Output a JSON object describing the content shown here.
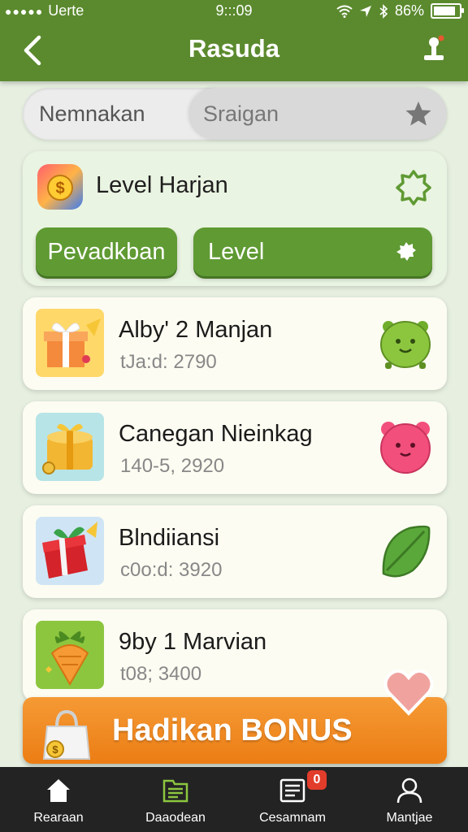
{
  "status_bar": {
    "carrier": "Uerte",
    "time": "9:::09",
    "battery": "86%",
    "battery_level": 0.86
  },
  "header": {
    "title": "Rasuda",
    "back_icon": "chevron-left-icon",
    "profile_icon": "profile-icon"
  },
  "segment": {
    "left_label": "Nemnakan",
    "right_label": "Sraigan",
    "right_icon": "star-icon"
  },
  "level_card": {
    "title": "Level Harjan",
    "primary_button": "Pevadkban",
    "secondary_button": "Level",
    "badge_icon": "gear-badge-icon"
  },
  "items": [
    {
      "name": "Alby' 2 Manjan",
      "sub": "tJa:d: 2790",
      "thumb_color": "#ffd86a",
      "pet_color": "#8cc63f"
    },
    {
      "name": "Canegan Nieinkag",
      "sub": "140-5, 2920",
      "thumb_color": "#b7e4e6",
      "pet_color": "#f24f7c"
    },
    {
      "name": "Blndiiansi",
      "sub": "c0o:d: 3920",
      "thumb_color": "#cfe5f5",
      "pet_color": "#5aa83a"
    },
    {
      "name": "9by 1 Marvian",
      "sub": "t08; 3400",
      "thumb_color": "#8cc63f",
      "pet_color": "#f59a35"
    }
  ],
  "bonus": {
    "label": "Hadikan BONUS"
  },
  "nav": [
    {
      "label": "Rearaan",
      "icon": "home-icon"
    },
    {
      "label": "Daaodean",
      "icon": "folder-icon"
    },
    {
      "label": "Cesamnam",
      "icon": "list-icon",
      "badge": "0"
    },
    {
      "label": "Mantjae",
      "icon": "user-icon"
    }
  ],
  "colors": {
    "header": "#5b8a2e",
    "button": "#5f9a33",
    "bonus": "#ec7d14",
    "nav_bg": "#232323"
  }
}
